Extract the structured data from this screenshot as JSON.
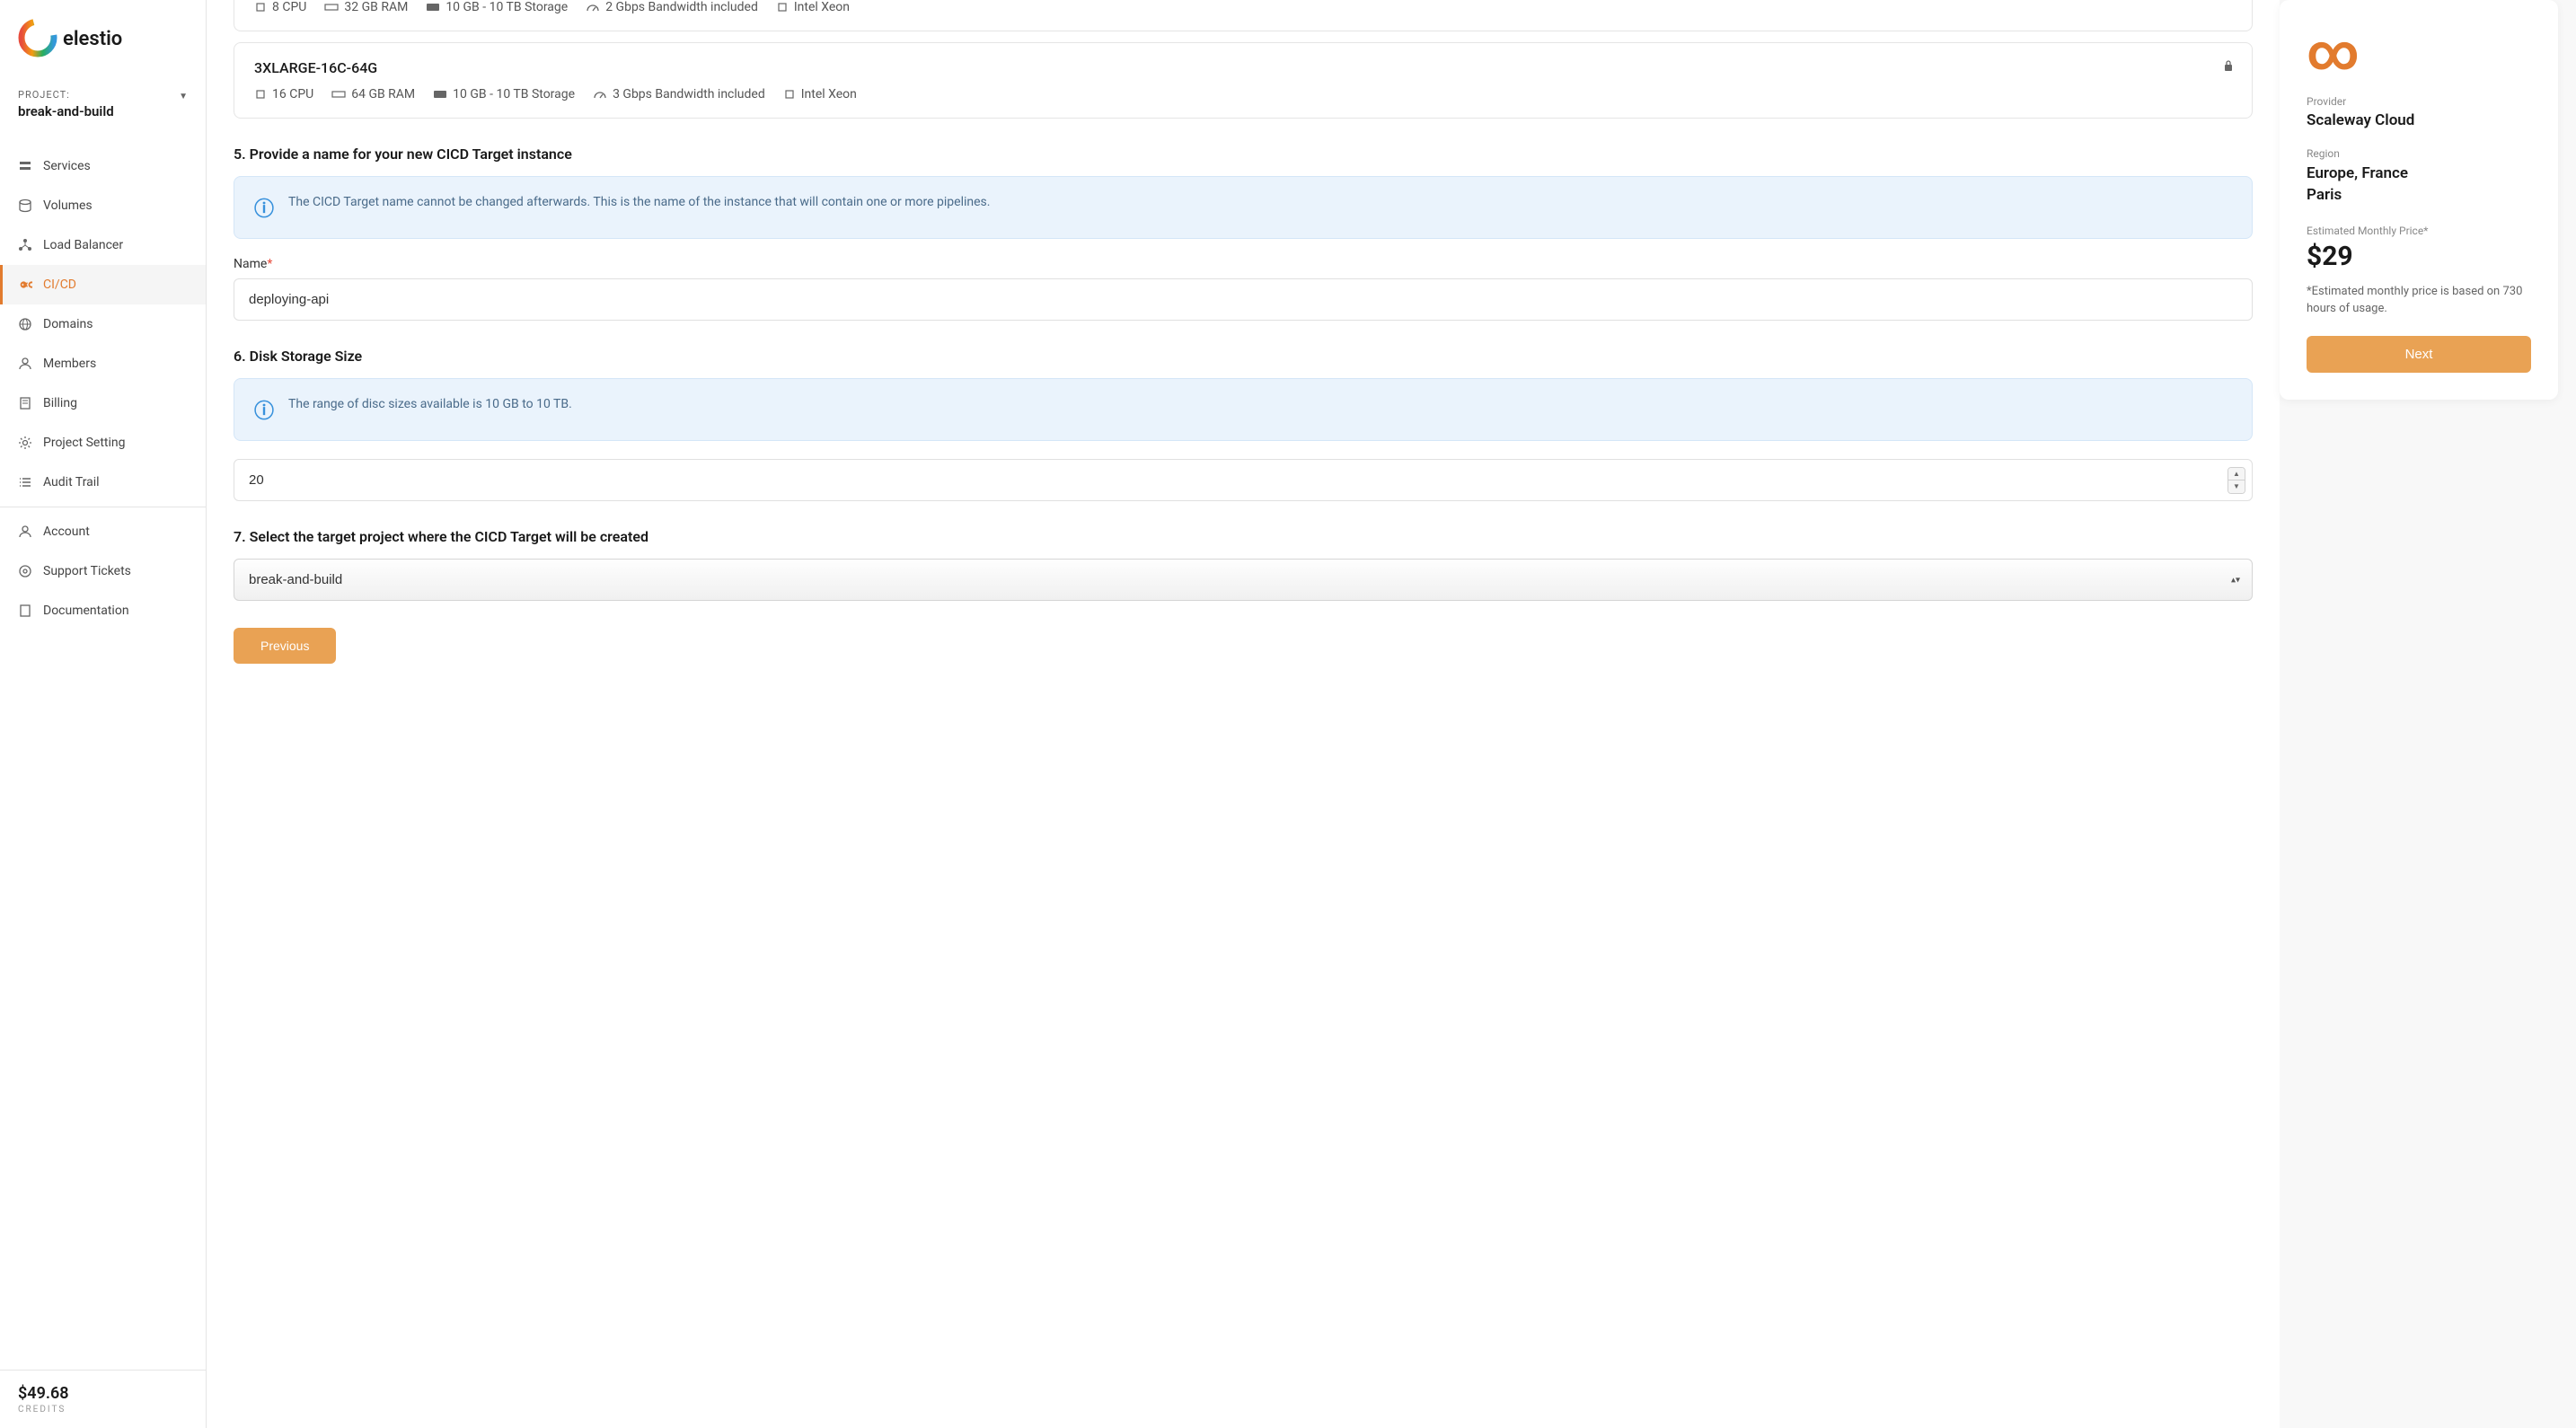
{
  "sidebar": {
    "project_label": "PROJECT:",
    "project_name": "break-and-build",
    "items": [
      {
        "label": "Services"
      },
      {
        "label": "Volumes"
      },
      {
        "label": "Load Balancer"
      },
      {
        "label": "CI/CD"
      },
      {
        "label": "Domains"
      },
      {
        "label": "Members"
      },
      {
        "label": "Billing"
      },
      {
        "label": "Project Setting"
      },
      {
        "label": "Audit Trail"
      },
      {
        "label": "Account"
      },
      {
        "label": "Support Tickets"
      },
      {
        "label": "Documentation"
      }
    ],
    "credits_amount": "$49.68",
    "credits_label": "CREDITS"
  },
  "topcard": {
    "specs": [
      "8 CPU",
      "32 GB RAM",
      "10 GB - 10 TB Storage",
      "2 Gbps Bandwidth included",
      "Intel Xeon"
    ]
  },
  "plancard": {
    "title": "3XLARGE-16C-64G",
    "specs": [
      "16 CPU",
      "64 GB RAM",
      "10 GB - 10 TB Storage",
      "3 Gbps Bandwidth included",
      "Intel Xeon"
    ]
  },
  "section5": {
    "heading": "5. Provide a name for your new CICD Target instance",
    "info": "The CICD Target name cannot be changed afterwards. This is the name of the instance that will contain one or more pipelines.",
    "name_label": "Name",
    "name_value": "deploying-api"
  },
  "section6": {
    "heading": "6. Disk Storage Size",
    "info": "The range of disc sizes available is 10 GB to 10 TB.",
    "size_value": "20"
  },
  "section7": {
    "heading": "7. Select the target project where the CICD Target will be created",
    "select_value": "break-and-build"
  },
  "previous_label": "Previous",
  "summary": {
    "provider_label": "Provider",
    "provider_value": "Scaleway Cloud",
    "region_label": "Region",
    "region_value1": "Europe, France",
    "region_value2": "Paris",
    "price_label": "Estimated Monthly Price*",
    "price_value": "$29",
    "price_note": "*Estimated monthly price is based on 730 hours of usage.",
    "next_label": "Next"
  }
}
